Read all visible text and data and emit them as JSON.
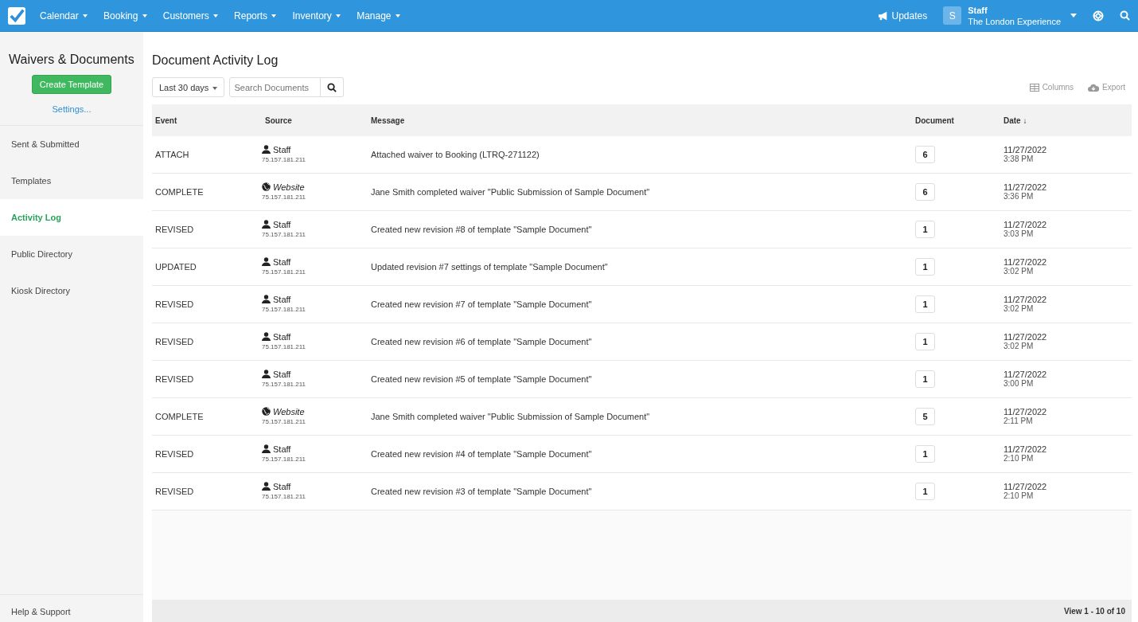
{
  "nav": {
    "menus": [
      "Calendar",
      "Booking",
      "Customers",
      "Reports",
      "Inventory",
      "Manage"
    ],
    "updates": "Updates",
    "user": {
      "initial": "S",
      "name": "Staff",
      "company": "The London Experience"
    }
  },
  "sidebar": {
    "title": "Waivers & Documents",
    "create_button": "Create Template",
    "settings_link": "Settings...",
    "items": [
      {
        "label": "Sent & Submitted",
        "selected": false
      },
      {
        "label": "Templates",
        "selected": false
      },
      {
        "label": "Activity Log",
        "selected": true
      },
      {
        "label": "Public Directory",
        "selected": false
      },
      {
        "label": "Kiosk Directory",
        "selected": false
      }
    ],
    "help": "Help & Support"
  },
  "page_title": "Document Activity Log",
  "toolbar": {
    "range": "Last 30 days",
    "search_placeholder": "Search Documents",
    "columns": "Columns",
    "export": "Export"
  },
  "table": {
    "columns": [
      "Event",
      "Source",
      "Message",
      "Document",
      "Date ↓"
    ],
    "rows": [
      {
        "event": "ATTACH",
        "source": {
          "kind": "staff",
          "name": "Staff",
          "ip": "75.157.181.211"
        },
        "message": "Attached waiver to Booking (LTRQ-271122)",
        "document": "6",
        "date": "11/27/2022",
        "time": "3:38 PM"
      },
      {
        "event": "COMPLETE",
        "source": {
          "kind": "website",
          "name": "Website",
          "ip": "75.157.181.211"
        },
        "message": "Jane Smith completed waiver \"Public Submission of Sample Document\"",
        "document": "6",
        "date": "11/27/2022",
        "time": "3:36 PM"
      },
      {
        "event": "REVISED",
        "source": {
          "kind": "staff",
          "name": "Staff",
          "ip": "75.157.181.211"
        },
        "message": "Created new revision #8 of template \"Sample Document\"",
        "document": "1",
        "date": "11/27/2022",
        "time": "3:03 PM"
      },
      {
        "event": "UPDATED",
        "source": {
          "kind": "staff",
          "name": "Staff",
          "ip": "75.157.181.211"
        },
        "message": "Updated revision #7 settings of template \"Sample Document\"",
        "document": "1",
        "date": "11/27/2022",
        "time": "3:02 PM"
      },
      {
        "event": "REVISED",
        "source": {
          "kind": "staff",
          "name": "Staff",
          "ip": "75.157.181.211"
        },
        "message": "Created new revision #7 of template \"Sample Document\"",
        "document": "1",
        "date": "11/27/2022",
        "time": "3:02 PM"
      },
      {
        "event": "REVISED",
        "source": {
          "kind": "staff",
          "name": "Staff",
          "ip": "75.157.181.211"
        },
        "message": "Created new revision #6 of template \"Sample Document\"",
        "document": "1",
        "date": "11/27/2022",
        "time": "3:02 PM"
      },
      {
        "event": "REVISED",
        "source": {
          "kind": "staff",
          "name": "Staff",
          "ip": "75.157.181.211"
        },
        "message": "Created new revision #5 of template \"Sample Document\"",
        "document": "1",
        "date": "11/27/2022",
        "time": "3:00 PM"
      },
      {
        "event": "COMPLETE",
        "source": {
          "kind": "website",
          "name": "Website",
          "ip": "75.157.181.211"
        },
        "message": "Jane Smith completed waiver \"Public Submission of Sample Document\"",
        "document": "5",
        "date": "11/27/2022",
        "time": "2:11 PM"
      },
      {
        "event": "REVISED",
        "source": {
          "kind": "staff",
          "name": "Staff",
          "ip": "75.157.181.211"
        },
        "message": "Created new revision #4 of template \"Sample Document\"",
        "document": "1",
        "date": "11/27/2022",
        "time": "2:10 PM"
      },
      {
        "event": "REVISED",
        "source": {
          "kind": "staff",
          "name": "Staff",
          "ip": "75.157.181.211"
        },
        "message": "Created new revision #3 of template \"Sample Document\"",
        "document": "1",
        "date": "11/27/2022",
        "time": "2:10 PM"
      }
    ]
  },
  "pager": "View 1 - 10 of 10"
}
